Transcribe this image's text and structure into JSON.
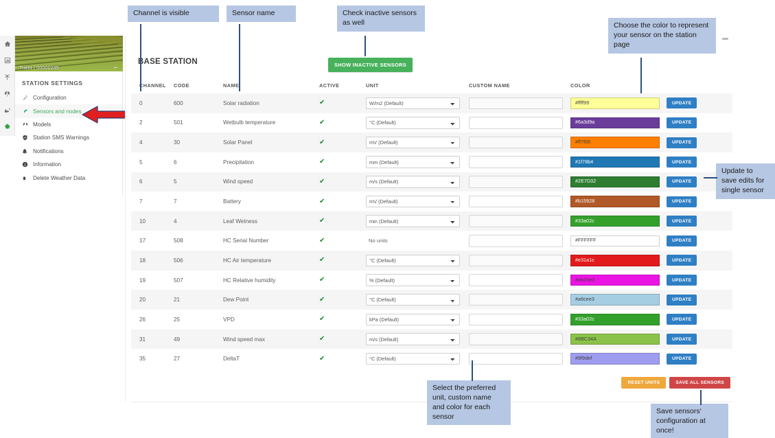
{
  "app": {
    "rail_icons": [
      "home-icon",
      "dashboard-icon",
      "weather-station-icon",
      "leaf-icon",
      "irrigation-icon",
      "gear-icon"
    ],
    "collapse_handle": "collapse-handle"
  },
  "sidebar": {
    "station_label": "Trient / 00000235",
    "section_title": "STATION SETTINGS",
    "items": [
      {
        "label": "Configuration",
        "icon": "wrench-icon",
        "selected": false
      },
      {
        "label": "Sensors and nodes",
        "icon": "sensor-icon",
        "selected": true
      },
      {
        "label": "Models",
        "icon": "models-icon",
        "selected": false
      },
      {
        "label": "Station SMS Warnings",
        "icon": "shield-icon",
        "selected": false
      },
      {
        "label": "Notifications",
        "icon": "bell-icon",
        "selected": false
      },
      {
        "label": "Information",
        "icon": "info-icon",
        "selected": false
      },
      {
        "label": "Delete Weather Data",
        "icon": "trash-icon",
        "selected": false
      }
    ]
  },
  "main": {
    "title": "BASE STATION",
    "show_inactive_label": "SHOW INACTIVE SENSORS",
    "columns": [
      "CHANNEL",
      "CODE",
      "NAME",
      "ACTIVE",
      "UNIT",
      "CUSTOM NAME",
      "COLOR"
    ],
    "update_label": "UPDATE",
    "reset_units_label": "RESET UNITS",
    "save_all_label": "SAVE ALL SENSORS",
    "custom_name_placeholder": "",
    "rows": [
      {
        "channel": "0",
        "code": "600",
        "name": "Solar radiation",
        "active": true,
        "unit": "W/m2 (Default)",
        "has_unit_select": true,
        "custom": "",
        "color_hex": "#ffff99",
        "color_label": "#ffff99",
        "text_dark": true
      },
      {
        "channel": "2",
        "code": "501",
        "name": "Wetbulb temperature",
        "active": true,
        "unit": "°C (Default)",
        "has_unit_select": true,
        "custom": "",
        "color_hex": "#6a3d9a",
        "color_label": "#6a3d9a",
        "text_dark": false
      },
      {
        "channel": "4",
        "code": "30",
        "name": "Solar Panel",
        "active": true,
        "unit": "mV (Default)",
        "has_unit_select": true,
        "custom": "",
        "color_hex": "#ff7f00",
        "color_label": "#ff7f00",
        "text_dark": true
      },
      {
        "channel": "5",
        "code": "6",
        "name": "Precipitation",
        "active": true,
        "unit": "mm (Default)",
        "has_unit_select": true,
        "custom": "",
        "color_hex": "#1f78b4",
        "color_label": "#1f78b4",
        "text_dark": false
      },
      {
        "channel": "6",
        "code": "5",
        "name": "Wind speed",
        "active": true,
        "unit": "m/s (Default)",
        "has_unit_select": true,
        "custom": "",
        "color_hex": "#2E7D32",
        "color_label": "#2E7D32",
        "text_dark": false
      },
      {
        "channel": "7",
        "code": "7",
        "name": "Battery",
        "active": true,
        "unit": "mV (Default)",
        "has_unit_select": true,
        "custom": "",
        "color_hex": "#b15928",
        "color_label": "#b15928",
        "text_dark": false
      },
      {
        "channel": "10",
        "code": "4",
        "name": "Leaf Wetness",
        "active": true,
        "unit": "min (Default)",
        "has_unit_select": true,
        "custom": "",
        "color_hex": "#33a02c",
        "color_label": "#33a02c",
        "text_dark": false
      },
      {
        "channel": "17",
        "code": "508",
        "name": "HC Serial Number",
        "active": true,
        "unit": "No units",
        "has_unit_select": false,
        "custom": "",
        "color_hex": "#FFFFFF",
        "color_label": "#FFFFFF",
        "text_dark": true
      },
      {
        "channel": "18",
        "code": "506",
        "name": "HC Air temperature",
        "active": true,
        "unit": "°C (Default)",
        "has_unit_select": true,
        "custom": "",
        "color_hex": "#e31a1c",
        "color_label": "#e31a1c",
        "text_dark": false
      },
      {
        "channel": "19",
        "code": "507",
        "name": "HC Relative humidity",
        "active": true,
        "unit": "% (Default)",
        "has_unit_select": true,
        "custom": "",
        "color_hex": "#eb15e3",
        "color_label": "#eb15e3",
        "text_dark": true
      },
      {
        "channel": "20",
        "code": "21",
        "name": "Dew Point",
        "active": true,
        "unit": "°C (Default)",
        "has_unit_select": true,
        "custom": "",
        "color_hex": "#a6cee3",
        "color_label": "#a6cee3",
        "text_dark": true
      },
      {
        "channel": "26",
        "code": "25",
        "name": "VPD",
        "active": true,
        "unit": "kPa (Default)",
        "has_unit_select": true,
        "custom": "",
        "color_hex": "#33a02c",
        "color_label": "#33a02c",
        "text_dark": false
      },
      {
        "channel": "31",
        "code": "49",
        "name": "Wind speed max",
        "active": true,
        "unit": "m/s (Default)",
        "has_unit_select": true,
        "custom": "",
        "color_hex": "#8BC34A",
        "color_label": "#8BC34A",
        "text_dark": true
      },
      {
        "channel": "35",
        "code": "27",
        "name": "DeltaT",
        "active": true,
        "unit": "°C (Default)",
        "has_unit_select": true,
        "custom": "",
        "color_hex": "#9f9def",
        "color_label": "#9f9def",
        "text_dark": true
      }
    ]
  },
  "annotations": [
    {
      "id": "channel-visible",
      "text": "Channel is visible"
    },
    {
      "id": "sensor-name",
      "text": "Sensor name"
    },
    {
      "id": "check-inactive",
      "text": "Check inactive sensors as well"
    },
    {
      "id": "choose-color",
      "text": "Choose the color to represent your sensor on the station page"
    },
    {
      "id": "update-single",
      "text": "Update to save edits for single sensor"
    },
    {
      "id": "select-unit",
      "text": "Select the preferred unit, custom name and color for each sensor"
    },
    {
      "id": "save-all",
      "text": "Save sensors‘ configuration at once!"
    }
  ],
  "colors": {
    "accent_green": "#48b15c",
    "update_blue": "#2f7fc4",
    "reset_orange": "#efa83c",
    "save_red": "#cf4646",
    "callout_blue": "#b6c7e3",
    "leader_navy": "#2d4f7c",
    "arrow_red": "#e02020"
  }
}
